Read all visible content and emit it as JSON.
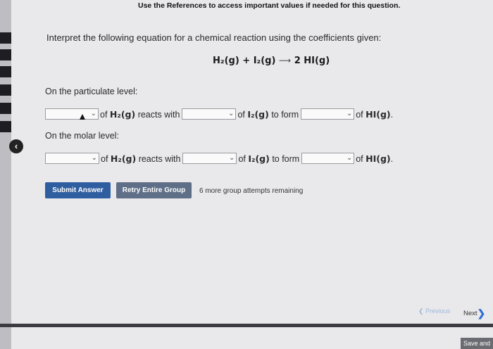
{
  "notice": "Use the References to access important values if needed for this question.",
  "prompt": "Interpret the following equation for a chemical reaction using the coefficients given:",
  "equation": {
    "left": "H₂(g) + I₂(g)",
    "arrow": "⟶",
    "right": "2 HI(g)"
  },
  "particulate": {
    "label": "On the particulate level:",
    "text1": "of ",
    "h2": "H₂(g)",
    "reacts": " reacts with",
    "text2": "of ",
    "i2": "I₂(g)",
    "form": " to form",
    "text3": "of ",
    "hi": "HI(g)",
    "end": "."
  },
  "molar": {
    "label": "On the molar level:",
    "text1": "of ",
    "h2": "H₂(g)",
    "reacts": " reacts with",
    "text2": "of ",
    "i2": "I₂(g)",
    "form": " to form",
    "text3": "of ",
    "hi": "HI(g)",
    "end": "."
  },
  "buttons": {
    "submit": "Submit Answer",
    "retry": "Retry Entire Group"
  },
  "attempts": "6 more group attempts remaining",
  "nav": {
    "previous": "Previous",
    "next": "Next"
  },
  "save": "Save and",
  "icons": {
    "collapse": "chevron-left-icon",
    "dropdown": "chevron-down-icon"
  },
  "colors": {
    "submit": "#2f5ea0",
    "retry": "#5f6f87"
  }
}
